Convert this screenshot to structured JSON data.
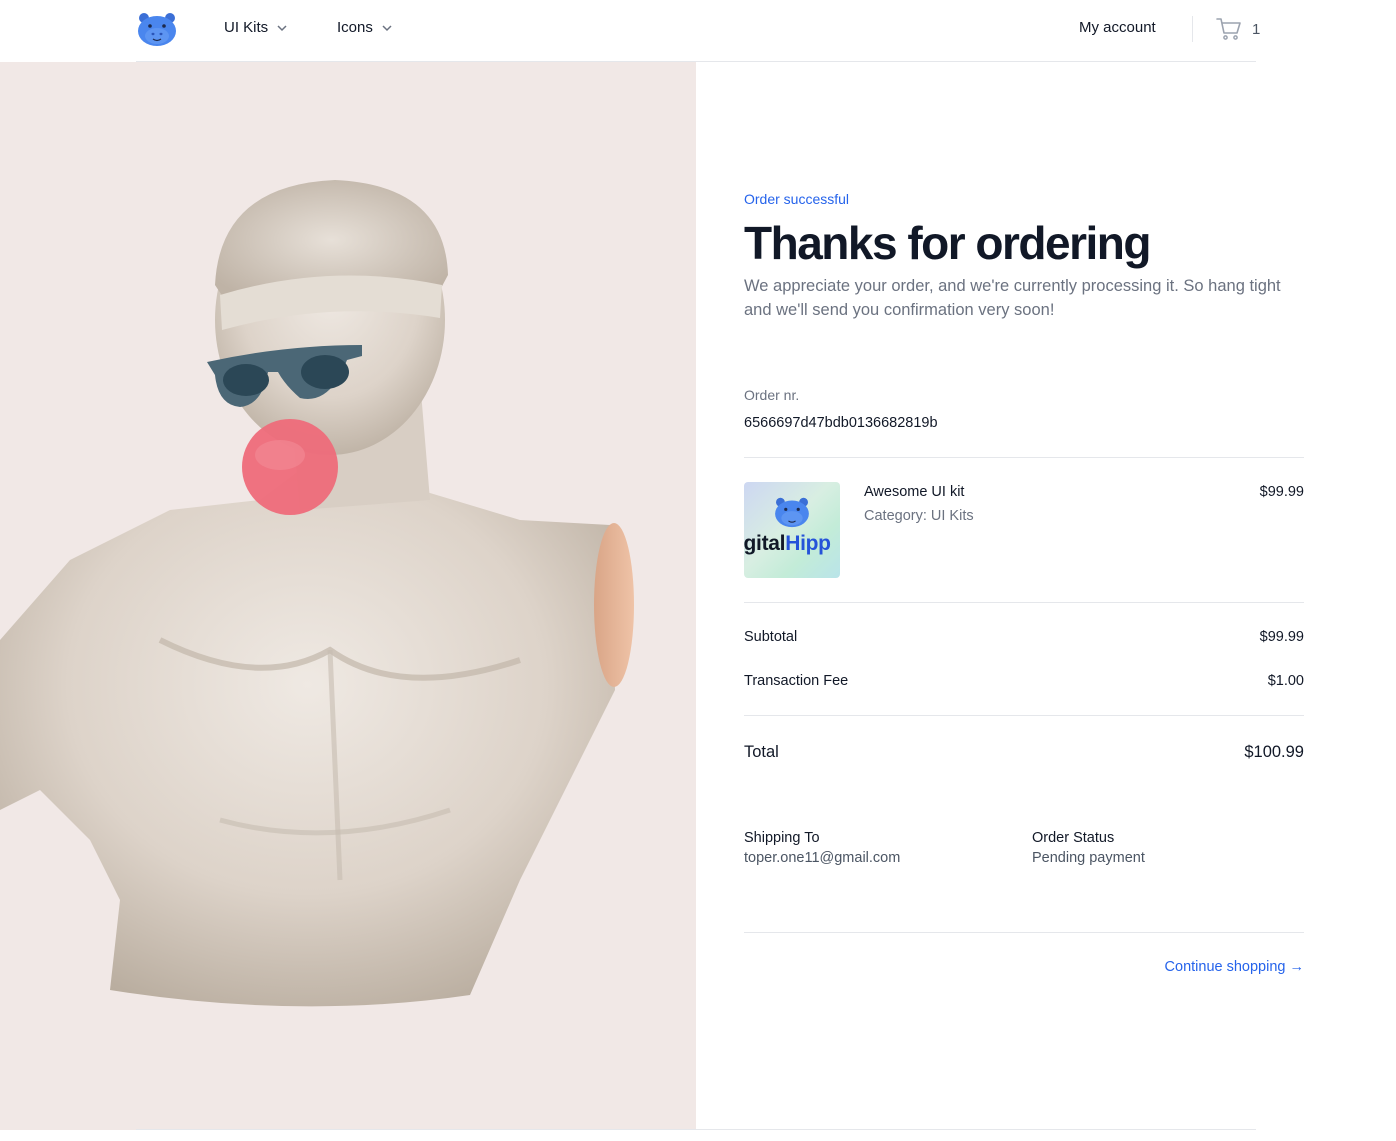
{
  "header": {
    "logo_icon": "hippo-logo-icon",
    "nav": [
      {
        "label": "UI Kits",
        "icon": "chevron-down-icon"
      },
      {
        "label": "Icons",
        "icon": "chevron-down-icon"
      }
    ],
    "my_account": "My account",
    "cart": {
      "icon": "cart-icon",
      "count": "1"
    }
  },
  "hero": {
    "image": "statue-with-sunglasses-and-bubblegum"
  },
  "order": {
    "eyebrow": "Order successful",
    "title": "Thanks for ordering",
    "subtitle": "We appreciate your order, and we're currently processing it. So hang tight and we'll send you confirmation very soon!",
    "order_nr_label": "Order nr.",
    "order_nr": "6566697d47bdb0136682819b",
    "items": [
      {
        "thumb_text_a": "igital",
        "thumb_text_b": "Hipp",
        "name": "Awesome UI kit",
        "category": "Category: UI Kits",
        "price": "$99.99"
      }
    ],
    "subtotal_label": "Subtotal",
    "subtotal": "$99.99",
    "fee_label": "Transaction Fee",
    "fee": "$1.00",
    "total_label": "Total",
    "total": "$100.99",
    "shipping_label": "Shipping To",
    "shipping_value": "toper.one11@gmail.com",
    "status_label": "Order Status",
    "status_value": "Pending payment",
    "continue_label": "Continue shopping →"
  },
  "colors": {
    "accent": "#2563eb",
    "hero_bg": "#f1e8e6",
    "text_primary": "#111827",
    "text_muted": "#6b7280",
    "divider": "#e5e7eb"
  }
}
